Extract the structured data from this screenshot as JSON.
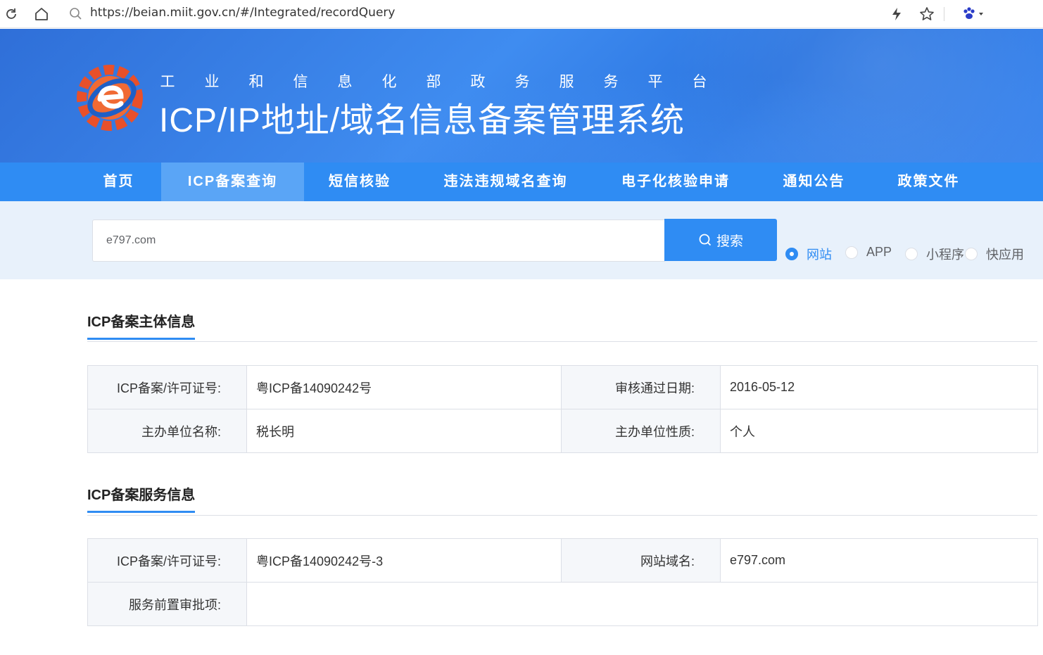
{
  "browser": {
    "url": "https://beian.miit.gov.cn/#/Integrated/recordQuery"
  },
  "header": {
    "subtitle_chars": [
      "工",
      "业",
      "和",
      "信",
      "息",
      "化",
      "部",
      "政",
      "务",
      "服",
      "务",
      "平",
      "台"
    ],
    "title": "ICP/IP地址/域名信息备案管理系统"
  },
  "nav": {
    "items": [
      {
        "label": "首页"
      },
      {
        "label": "ICP备案查询"
      },
      {
        "label": "短信核验"
      },
      {
        "label": "违法违规域名查询"
      },
      {
        "label": "电子化核验申请"
      },
      {
        "label": "通知公告"
      },
      {
        "label": "政策文件"
      }
    ],
    "active": "ICP备案查询"
  },
  "search": {
    "value": "e797.com",
    "button_label": "搜索",
    "types": [
      {
        "label": "网站",
        "checked": true
      },
      {
        "label": "APP",
        "checked": false
      },
      {
        "label": "小程序",
        "checked": false
      },
      {
        "label": "快应用",
        "checked": false
      }
    ]
  },
  "subject_info": {
    "title": "ICP备案主体信息",
    "rows": [
      {
        "l1": "ICP备案/许可证号:",
        "v1": "粤ICP备14090242号",
        "l2": "审核通过日期:",
        "v2": "2016-05-12"
      },
      {
        "l1": "主办单位名称:",
        "v1": "税长明",
        "l2": "主办单位性质:",
        "v2": "个人"
      }
    ]
  },
  "service_info": {
    "title": "ICP备案服务信息",
    "row1": {
      "l1": "ICP备案/许可证号:",
      "v1": "粤ICP备14090242号-3",
      "l2": "网站域名:",
      "v2": "e797.com"
    },
    "row2": {
      "l1": "服务前置审批项:",
      "v1": ""
    }
  },
  "colors": {
    "primary": "#2f8cf3",
    "banner": "#3480e6",
    "nav_active": "#5aa5f6",
    "search_band": "#e8f1fb",
    "label_bg": "#f5f7fa"
  }
}
